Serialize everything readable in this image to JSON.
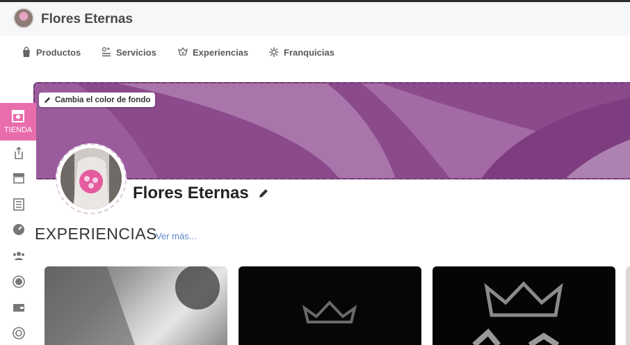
{
  "header": {
    "brand": "Flores Eternas"
  },
  "nav": [
    {
      "label": "Productos",
      "icon": "shopping-bag-icon"
    },
    {
      "label": "Servicios",
      "icon": "services-icon"
    },
    {
      "label": "Experiencias",
      "icon": "experiences-icon"
    },
    {
      "label": "Franquicias",
      "icon": "franchise-icon"
    }
  ],
  "banner": {
    "change_bg_label": "Cambia el color de fondo"
  },
  "sidebar": {
    "active_label": "TIENDA",
    "icons": [
      "share-icon",
      "store-icon",
      "list-icon",
      "dashboard-icon",
      "users-icon",
      "money-icon",
      "wallet-icon",
      "target-icon"
    ]
  },
  "profile": {
    "name": "Flores Eternas"
  },
  "section": {
    "title": "EXPERIENCIAS",
    "see_more": "Ver más..."
  },
  "colors": {
    "accent": "#e96cab",
    "banner": "#8e4b8f",
    "link": "#5b87c7"
  }
}
